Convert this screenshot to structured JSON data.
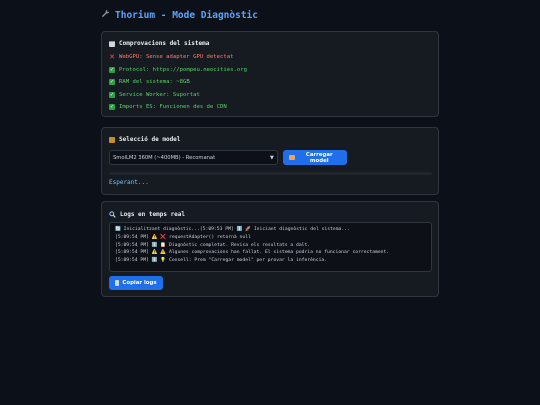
{
  "header": {
    "icon": "wrench-icon",
    "title": "Thorium - Mode Diagnòstic"
  },
  "checks": {
    "title": "Comprovacions del sistema",
    "title_icon": "clipboard-icon",
    "items": [
      {
        "status": "error",
        "icon": "cross-icon",
        "text": "WebGPU: Sense adapter GPU detectat"
      },
      {
        "status": "ok",
        "icon": "check-icon",
        "text": "Protocol: https://pompeu.neocities.org"
      },
      {
        "status": "ok",
        "icon": "check-icon",
        "text": "RAM del sistema: ~8GB"
      },
      {
        "status": "ok",
        "icon": "check-icon",
        "text": "Service Worker: Suportat"
      },
      {
        "status": "ok",
        "icon": "check-icon",
        "text": "Imports ES: Funcionen des de CDN"
      }
    ]
  },
  "model": {
    "title": "Selecció de model",
    "title_icon": "package-icon",
    "selected": "SmolLM2 360M (~400MB) - Recomanat",
    "load_button": "Carregar model",
    "load_icon": "inbox-tray-icon",
    "progress": 0,
    "status": "Esperant..."
  },
  "logs": {
    "title": "Logs en temps real",
    "title_icon": "magnifier-icon",
    "lines": [
      "🔄 Inicialitzant diagnòstic...[5:09:53 PM] ℹ️ 🚀 Iniciant diagnòstic del sistema...",
      "[5:09:54 PM] ⚠️ ❌ requestAdapter() retornà null",
      "[5:09:54 PM] ℹ️ 📋 Diagnòstic completat. Revisa els resultats a dalt.",
      "[5:09:54 PM] ⚠️ ⚠️ Algunes comprovacions han fallat. El sistema podria no funcionar correctament.",
      "[5:09:54 PM] ℹ️ 💡 Consell: Prem \"Carregar model\" per provar la inferència."
    ],
    "copy_button": "Copiar logs",
    "copy_icon": "clipboard-icon"
  },
  "colors": {
    "accent": "#1f6feb",
    "title": "#58a6ff",
    "ok": "#2ea043",
    "error": "#f85149",
    "background": "#0c1018",
    "card": "#161b22"
  }
}
